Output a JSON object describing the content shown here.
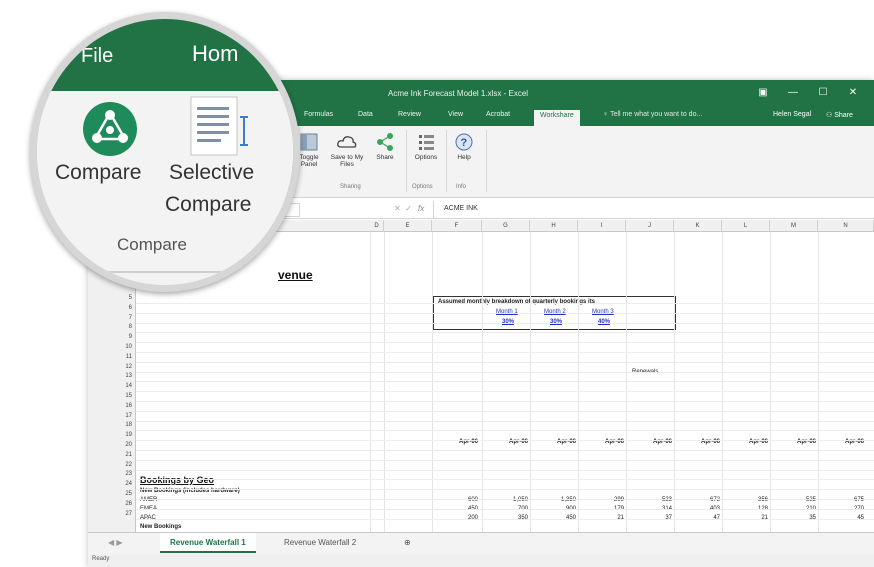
{
  "window": {
    "title": "Acme Ink Forecast Model 1.xlsx - Excel",
    "controls": [
      "▣",
      "—",
      "☐",
      "✕"
    ]
  },
  "ribbon_tabs": [
    "Formulas",
    "Data",
    "Review",
    "View",
    "Acrobat",
    "Workshare"
  ],
  "tell_me": "Tell me what you want to do...",
  "user": "Helen Segal",
  "share": "Share",
  "ribbon": {
    "toggle_panel": "Toggle Panel",
    "save_files": "Save to My Files",
    "share_btn": "Share",
    "options": "Options",
    "help": "Help",
    "group_sharing": "Sharing",
    "group_options": "Options",
    "group_info": "Info"
  },
  "formula_bar": {
    "fx": "fx",
    "value": "ACME INK"
  },
  "columns": [
    "D",
    "E",
    "F",
    "G",
    "H",
    "I",
    "J",
    "K",
    "L",
    "M",
    "N"
  ],
  "rows": [
    "5",
    "6",
    "7",
    "8",
    "9",
    "10",
    "11",
    "12",
    "13",
    "14",
    "15",
    "16",
    "17",
    "18",
    "19",
    "20",
    "21",
    "22",
    "23",
    "24",
    "25",
    "26",
    "27"
  ],
  "sheet": {
    "revenue_title": "venue",
    "assume_title": "Assumed monthly breakdown of quarterly bookings its",
    "months": [
      "Month 1",
      "Month 2",
      "Month 3"
    ],
    "month_pcts": [
      "30%",
      "30%",
      "40%"
    ],
    "renewals": "Renewals",
    "date_headers": [
      "Apr-06",
      "Apr-06",
      "Apr-06",
      "Apr-06",
      "Apr-06",
      "Apr-06",
      "Apr-06",
      "Apr-06",
      "Apr-06"
    ],
    "bookings_by_geo": "Bookings by Geo",
    "new_bookings": "New Bookings (includes hardware)",
    "geo_rows": [
      {
        "num": "24",
        "label": "AMER",
        "values": [
          "600",
          "1,050",
          "1,350",
          "299",
          "523",
          "672",
          "356",
          "525",
          "675"
        ]
      },
      {
        "num": "25",
        "label": "EMEA",
        "values": [
          "450",
          "700",
          "900",
          "179",
          "314",
          "403",
          "128",
          "210",
          "270"
        ]
      },
      {
        "num": "26",
        "label": "APAC",
        "values": [
          "200",
          "350",
          "450",
          "21",
          "37",
          "47",
          "21",
          "35",
          "45"
        ]
      },
      {
        "num": "27",
        "label": "New Bookings",
        "values": []
      }
    ]
  },
  "sheet_tabs": [
    "Revenue Waterfall 1",
    "Revenue Waterfall 2"
  ],
  "status": "Ready",
  "magnifier": {
    "file": "File",
    "home": "Hom",
    "compare": "Compare",
    "selective_1": "Selective",
    "selective_2": "Compare",
    "group": "Compare",
    "edge": "C"
  },
  "colors": {
    "excel_green": "#217346",
    "compare_green": "#1f8a5a",
    "blue_link": "#2030c0"
  }
}
